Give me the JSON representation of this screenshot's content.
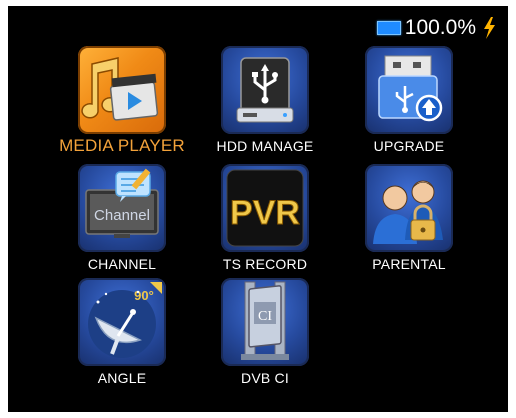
{
  "status": {
    "battery_percent": "100.0%",
    "battery_icon": "battery-icon",
    "charge_icon": "lightning-bolt-icon"
  },
  "menu": {
    "items": [
      {
        "label": "MEDIA PLAYER",
        "icon": "media-player-icon",
        "selected": true
      },
      {
        "label": "HDD MANAGE",
        "icon": "usb-drive-icon",
        "selected": false
      },
      {
        "label": "UPGRADE",
        "icon": "usb-upgrade-icon",
        "selected": false
      },
      {
        "label": "CHANNEL",
        "icon": "tv-channel-icon",
        "selected": false,
        "icon_text": "Channel"
      },
      {
        "label": "TS RECORD",
        "icon": "pvr-icon",
        "selected": false,
        "icon_text": "PVR"
      },
      {
        "label": "PARENTAL",
        "icon": "parental-lock-icon",
        "selected": false
      },
      {
        "label": "ANGLE",
        "icon": "satellite-dish-icon",
        "selected": false,
        "icon_text": "90°"
      },
      {
        "label": "DVB CI",
        "icon": "ci-card-icon",
        "selected": false,
        "icon_text": "CI"
      }
    ]
  },
  "colors": {
    "background": "#000000",
    "selected_label": "#f3a23a",
    "label": "#ffffff",
    "tile_blue": "#264a9e",
    "tile_orange": "#f08a16"
  }
}
